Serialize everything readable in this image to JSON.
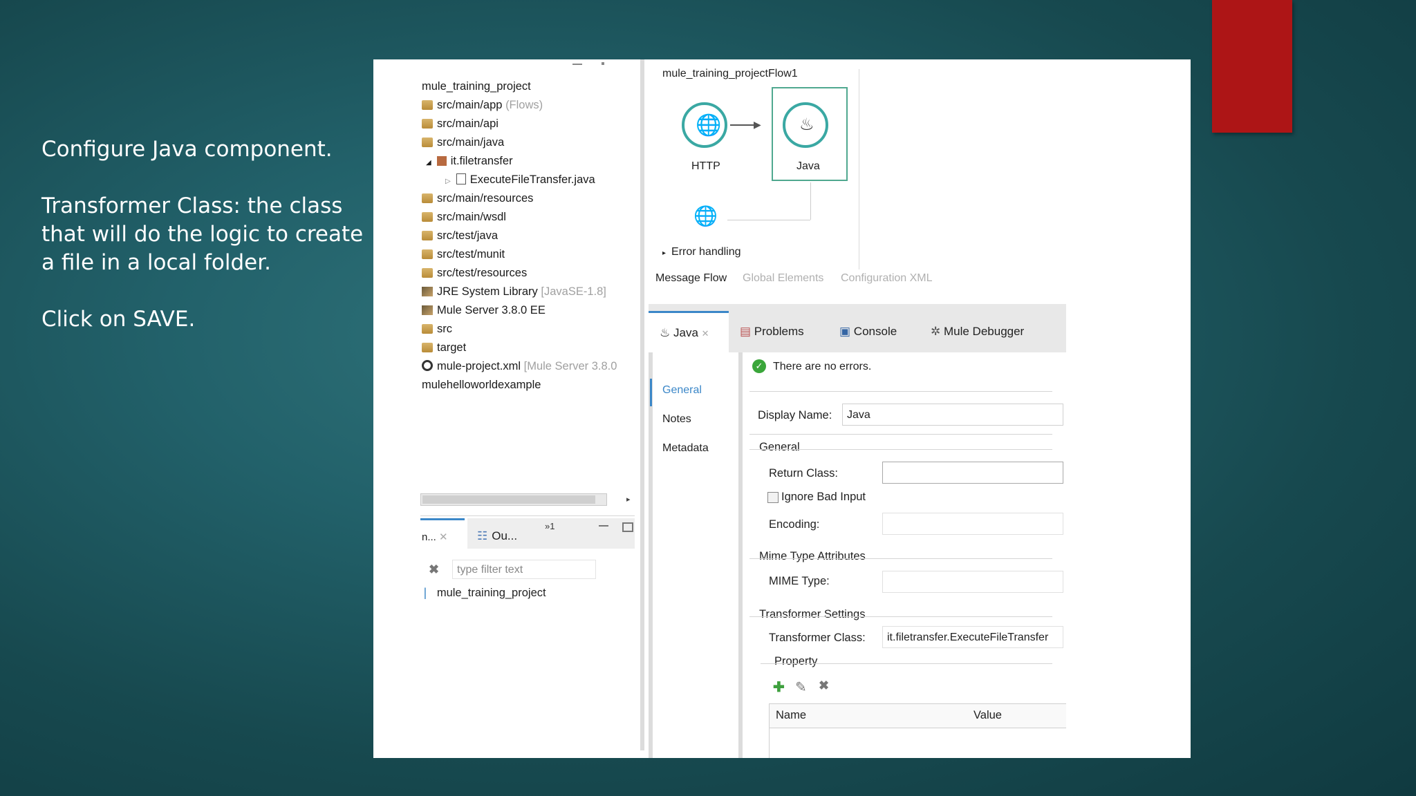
{
  "slide": {
    "instructions": [
      "Configure Java component.",
      "Transformer Class: the class that will do the logic to create a file in a local folder.",
      "Click on SAVE."
    ],
    "accent_color": "#ad1516"
  },
  "package_explorer": {
    "items": [
      {
        "label": "mule_training_project",
        "note": "",
        "icon": "project-icon"
      },
      {
        "label": "src/main/app",
        "note": "(Flows)",
        "icon": "folder-icon"
      },
      {
        "label": "src/main/api",
        "note": "",
        "icon": "folder-icon"
      },
      {
        "label": "src/main/java",
        "note": "",
        "icon": "folder-icon"
      },
      {
        "label": "it.filetransfer",
        "note": "",
        "icon": "package-icon"
      },
      {
        "label": "ExecuteFileTransfer.java",
        "note": "",
        "icon": "java-file-icon"
      },
      {
        "label": "src/main/resources",
        "note": "",
        "icon": "folder-icon"
      },
      {
        "label": "src/main/wsdl",
        "note": "",
        "icon": "folder-icon"
      },
      {
        "label": "src/test/java",
        "note": "",
        "icon": "folder-icon"
      },
      {
        "label": "src/test/munit",
        "note": "",
        "icon": "folder-icon"
      },
      {
        "label": "src/test/resources",
        "note": "",
        "icon": "folder-icon"
      },
      {
        "label": "JRE System Library",
        "note": "[JavaSE-1.8]",
        "icon": "library-icon"
      },
      {
        "label": "Mule Server 3.8.0 EE",
        "note": "",
        "icon": "library-icon"
      },
      {
        "label": "src",
        "note": "",
        "icon": "folder-icon"
      },
      {
        "label": "target",
        "note": "",
        "icon": "folder-icon"
      },
      {
        "label": "mule-project.xml",
        "note": "[Mule Server 3.8.0",
        "icon": "gear-icon"
      },
      {
        "label": "mulehelloworldexample",
        "note": "",
        "icon": "project-icon"
      }
    ]
  },
  "outline_panel": {
    "tab_short": "n...",
    "tab_outline": "Ou...",
    "badge": "1",
    "filter_placeholder": "type filter text",
    "project": "mule_training_project"
  },
  "canvas": {
    "flow_name": "mule_training_projectFlow1",
    "nodes": [
      {
        "label": "HTTP"
      },
      {
        "label": "Java"
      }
    ],
    "error_handling": "Error handling",
    "bottom_tabs": [
      "Message Flow",
      "Global Elements",
      "Configuration XML"
    ]
  },
  "properties": {
    "tabs": [
      "Java",
      "Problems",
      "Console",
      "Mule Debugger"
    ],
    "status_message": "There are no errors.",
    "side_tabs": [
      "General",
      "Notes",
      "Metadata"
    ],
    "display_name_label": "Display Name:",
    "display_name_value": "Java",
    "general_header": "General",
    "return_class_label": "Return Class:",
    "return_class_value": "",
    "ignore_bad_input_label": "Ignore Bad Input",
    "encoding_label": "Encoding:",
    "mime_header": "Mime Type Attributes",
    "mime_type_label": "MIME Type:",
    "transformer_header": "Transformer Settings",
    "transformer_class_label": "Transformer Class:",
    "transformer_class_value": "it.filetransfer.ExecuteFileTransfer",
    "property_header": "Property",
    "table_columns": [
      "Name",
      "Value"
    ]
  }
}
